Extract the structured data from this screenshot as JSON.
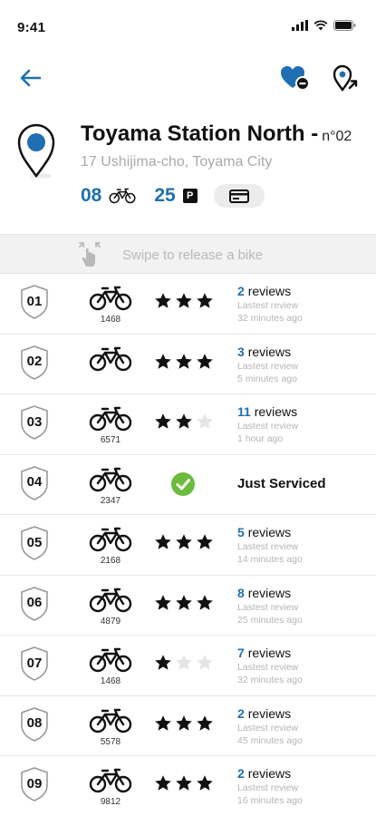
{
  "status": {
    "time": "9:41"
  },
  "station": {
    "name": "Toyama Station North -",
    "number": "n°02",
    "address": "17 Ushijima-cho, Toyama City",
    "bikes_available": "08",
    "parking_available": "25",
    "parking_badge": "P"
  },
  "swipe": {
    "label": "Swipe to release a bike"
  },
  "review_word": "reviews",
  "latest_label": "Lastest review",
  "colors": {
    "accent": "#1f6fb2",
    "check": "#6cbb3c"
  },
  "bikes": [
    {
      "slot": "01",
      "id": "1468",
      "rating": 3,
      "reviews": "2",
      "latest": "32 minutes ago"
    },
    {
      "slot": "02",
      "id": "",
      "rating": 3,
      "reviews": "3",
      "latest": "5 minutes ago"
    },
    {
      "slot": "03",
      "id": "6571",
      "rating": 2,
      "reviews": "11",
      "latest": "1 hour ago"
    },
    {
      "slot": "04",
      "id": "2347",
      "serviced": true,
      "status": "Just Serviced"
    },
    {
      "slot": "05",
      "id": "2168",
      "rating": 3,
      "reviews": "5",
      "latest": "14 minutes ago"
    },
    {
      "slot": "06",
      "id": "4879",
      "rating": 3,
      "reviews": "8",
      "latest": "25 minutes ago"
    },
    {
      "slot": "07",
      "id": "1468",
      "rating": 1,
      "reviews": "7",
      "latest": "32 minutes ago"
    },
    {
      "slot": "08",
      "id": "5578",
      "rating": 3,
      "reviews": "2",
      "latest": "45 minutes ago"
    },
    {
      "slot": "09",
      "id": "9812",
      "rating": 3,
      "reviews": "2",
      "latest": "16 minutes ago"
    }
  ]
}
